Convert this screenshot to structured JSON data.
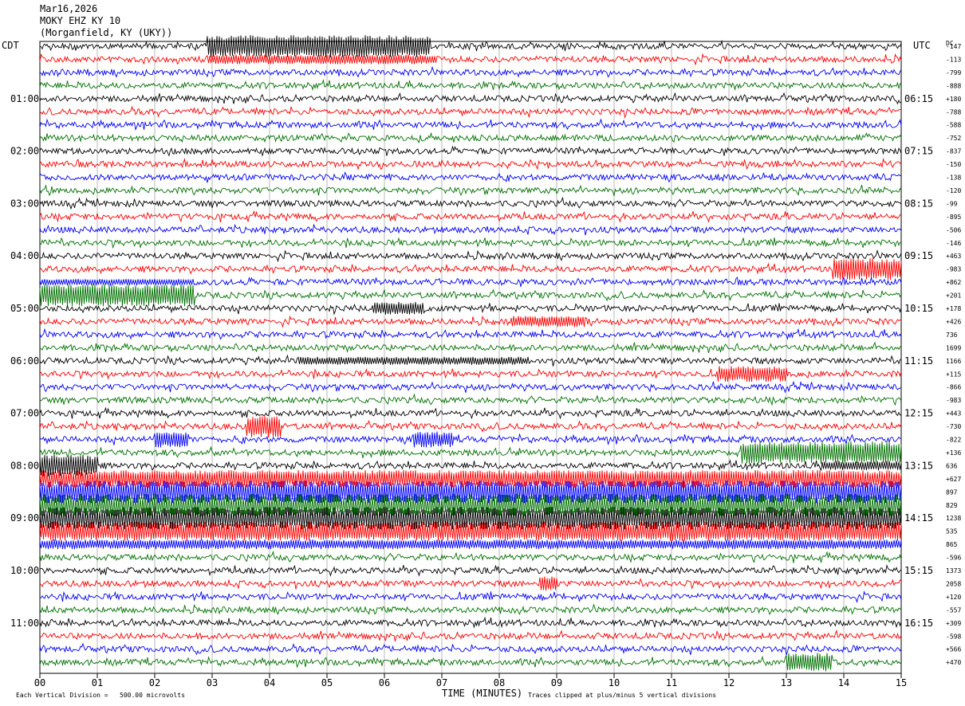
{
  "header": {
    "date": "Mar16,2026",
    "station": "MOKY EHZ KY 10",
    "location": "(Morganfield, KY (UKY))"
  },
  "chart_data": {
    "type": "line",
    "title": "Mar16,2026 MOKY EHZ KY 10 (Morganfield, KY (UKY))",
    "xlabel": "TIME (MINUTES)",
    "x_ticks": [
      "00",
      "01",
      "02",
      "03",
      "04",
      "05",
      "06",
      "07",
      "08",
      "09",
      "10",
      "11",
      "12",
      "13",
      "14",
      "15"
    ],
    "xlim": [
      0,
      15
    ],
    "left_axis_label": "CDT",
    "right_axis_label": "UTC",
    "dc_label": "DC",
    "left_times": [
      "01:00",
      "02:00",
      "03:00",
      "04:00",
      "05:00",
      "06:00",
      "07:00",
      "08:00",
      "09:00",
      "10:00",
      "11:00"
    ],
    "right_times": [
      "06:15",
      "07:15",
      "08:15",
      "09:15",
      "10:15",
      "11:15",
      "12:15",
      "13:15",
      "14:15",
      "15:15",
      "16:15"
    ],
    "trace_colors": [
      "#000000",
      "#ff0000",
      "#0000ff",
      "#007000"
    ],
    "dc_offsets": [
      "-147",
      "-113",
      "-799",
      "-888",
      "+180",
      "-788",
      "-588",
      "-752",
      "-837",
      "-150",
      "-138",
      "-120",
      "-99",
      "-895",
      "-506",
      "-146",
      "+463",
      "-983",
      "+862",
      "+201",
      "+178",
      "+426",
      "736",
      "1699",
      "1166",
      "+115",
      "-866",
      "-983",
      "+443",
      "-730",
      "-822",
      "+136",
      "636",
      "+627",
      "897",
      "829",
      "1238",
      "535",
      "865",
      "-596",
      "1373",
      "2058",
      "+120",
      "-557",
      "+309",
      "-598",
      "+566",
      "+470"
    ],
    "scale_note": "Each Vertical Division =   500.00 microvolts",
    "clip_note": "Traces clipped at plus/minus 5 vertical divisions",
    "grid": true
  }
}
